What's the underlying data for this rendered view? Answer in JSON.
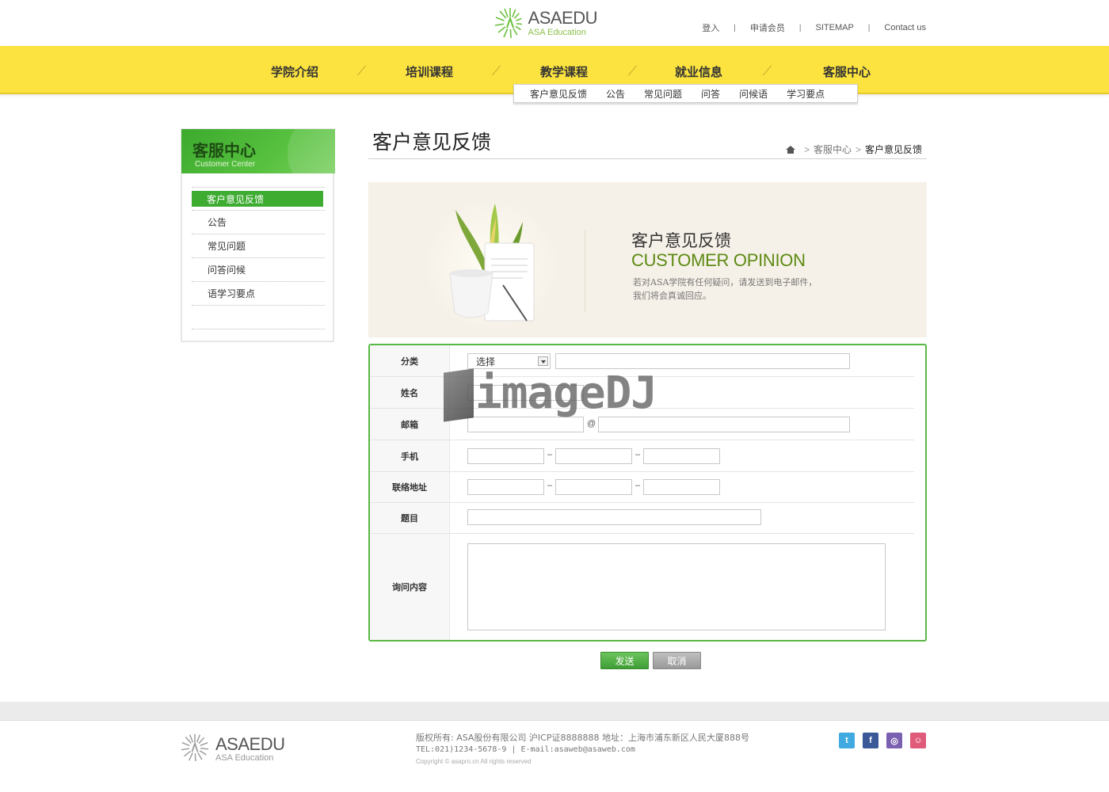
{
  "header": {
    "logo_name": "ASAEDU",
    "logo_sub": "ASA Education",
    "top_links": [
      "登入",
      "申请会员",
      "SITEMAP",
      "Contact us"
    ]
  },
  "nav": {
    "items": [
      "学院介绍",
      "培训课程",
      "教学课程",
      "就业信息",
      "客服中心"
    ],
    "sub_items": [
      "客户意见反馈",
      "公告",
      "常见问题",
      "问答",
      "问候语",
      "学习要点"
    ]
  },
  "sidebar": {
    "title": "客服中心",
    "subtitle": "Customer Center",
    "items": [
      "客户意见反馈",
      "公告",
      "常见问题",
      "问答问候",
      "语学习要点"
    ]
  },
  "page": {
    "title": "客户意见反馈",
    "breadcrumb": [
      "客服中心",
      "客户意见反馈"
    ]
  },
  "banner": {
    "title": "客户意见反馈",
    "title_en": "CUSTOMER OPINION",
    "desc_line1": "若对ASA学院有任何疑问，请发送到电子邮件，",
    "desc_line2": "我们将会真诚回应。"
  },
  "form": {
    "labels": {
      "category": "分类",
      "name": "姓名",
      "email": "邮箱",
      "mobile": "手机",
      "address": "联络地址",
      "subject": "题目",
      "content": "询问内容"
    },
    "category_select": "选择",
    "email_at": "@",
    "dash": "–"
  },
  "buttons": {
    "send": "发送",
    "cancel": "取消"
  },
  "watermark": "imageDJ",
  "footer": {
    "logo_name": "ASAEDU",
    "logo_sub": "ASA Education",
    "line1": "版权所有: ASA股份有限公司 沪ICP证8888888 地址：上海市浦东新区人民大厦888号",
    "line2": "TEL:021)1234-5678-9 | E-mail:asaweb@asaweb.com",
    "line3": "Copyright © asapro.cn All rights reserved",
    "social": [
      "twitter-icon",
      "facebook-icon",
      "blog-icon",
      "me2day-icon"
    ],
    "social_colors": [
      "#3fa9e0",
      "#3b5998",
      "#7b5fb1",
      "#e05a7a"
    ]
  }
}
